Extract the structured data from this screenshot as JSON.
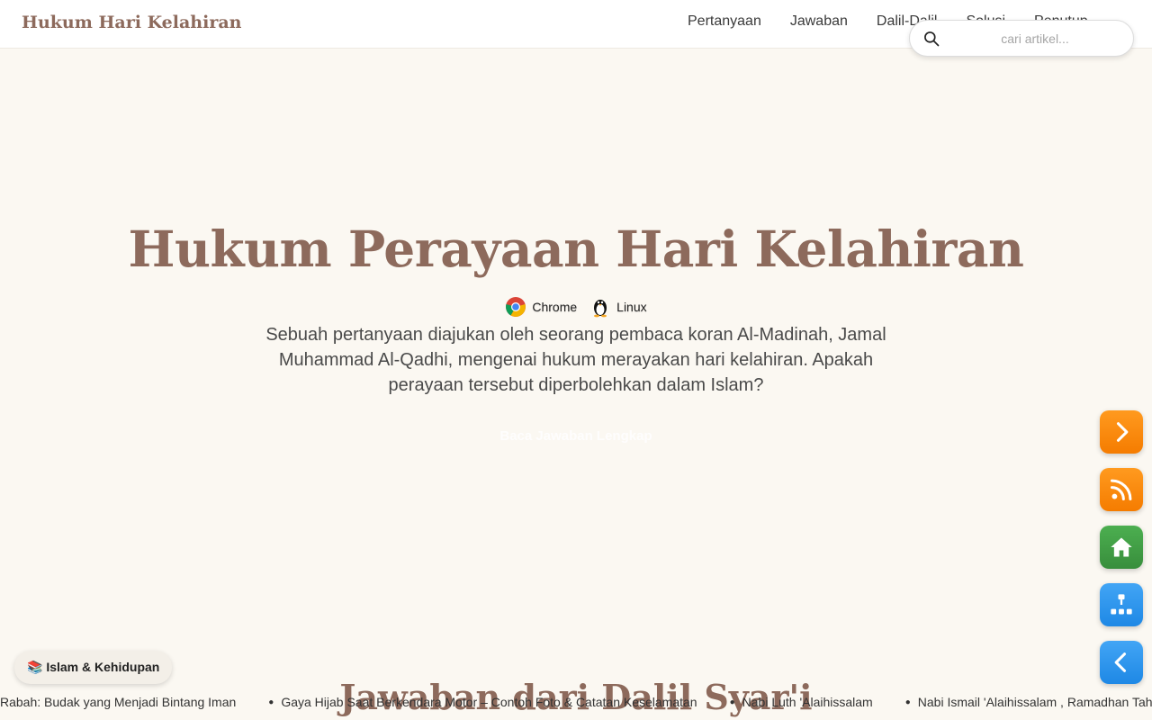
{
  "header": {
    "brand": "Hukum Hari Kelahiran",
    "nav": [
      {
        "label": "Pertanyaan"
      },
      {
        "label": "Jawaban"
      },
      {
        "label": "Dalil-Dalil"
      },
      {
        "label": "Solusi"
      },
      {
        "label": "Penutup"
      }
    ],
    "search": {
      "placeholder": "cari artikel...",
      "value": "",
      "icon": "search-icon"
    }
  },
  "hero": {
    "title": "Hukum Perayaan Hari Kelahiran",
    "badges": [
      {
        "label": "Chrome",
        "icon": "chrome-icon"
      },
      {
        "label": "Linux",
        "icon": "linux-penguin-icon"
      }
    ],
    "description": "Sebuah pertanyaan diajukan oleh seorang pembaca koran Al-Madinah, Jamal Muhammad Al-Qadhi, mengenai hukum merayakan hari kelahiran. Apakah perayaan tersebut diperbolehkan dalam Islam?",
    "cta": "Baca Jawaban Lengkap"
  },
  "section_heading": "Jawaban dari Dalil Syar'i",
  "ticker": [
    "Rabah: Budak yang Menjadi Bintang Iman",
    "Gaya Hijab Saat Berkendara Motor – Contoh Foto & Catatan Keselamatan",
    "Nabi Luth 'Alaihissalam",
    "Nabi Ismail 'Alaihissalam , Ramadhan Tahun Ini"
  ],
  "chip": {
    "label": "📚 Islam & Kehidupan"
  },
  "side_buttons": [
    {
      "name": "next",
      "icon": "chevron-right-icon",
      "color": "#f57c00"
    },
    {
      "name": "rss",
      "icon": "rss-icon",
      "color": "#f57c00"
    },
    {
      "name": "home",
      "icon": "home-icon",
      "color": "#43a047"
    },
    {
      "name": "sitemap",
      "icon": "sitemap-icon",
      "color": "#1e88e5"
    },
    {
      "name": "back",
      "icon": "chevron-left-icon",
      "color": "#1e88e5"
    }
  ],
  "colors": {
    "brand": "#8d6a5c",
    "background": "#fbf8f2",
    "orange": "#f57c00",
    "green": "#43a047",
    "blue": "#1e88e5"
  }
}
